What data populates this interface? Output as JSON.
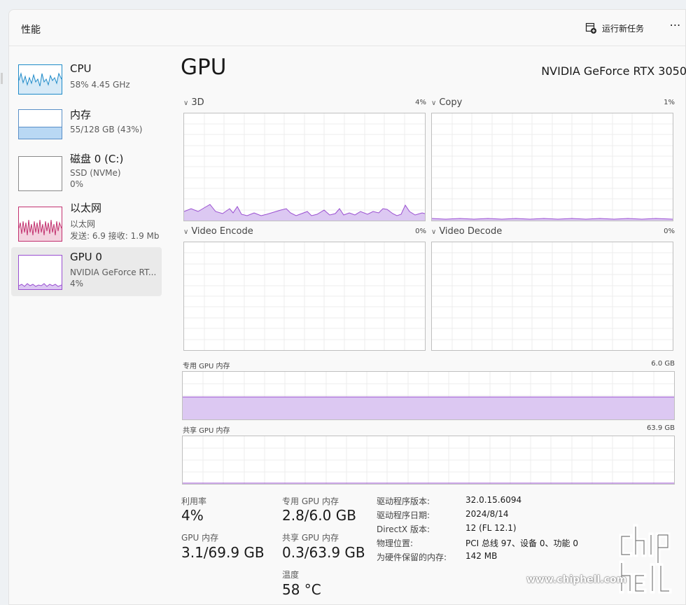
{
  "header": {
    "title": "性能",
    "run_task": "运行新任务",
    "more": "⋯"
  },
  "sidebar": {
    "items": [
      {
        "name": "CPU",
        "sub1": "58% 4.45 GHz",
        "sub2": ""
      },
      {
        "name": "内存",
        "sub1": "55/128 GB (43%)",
        "sub2": ""
      },
      {
        "name": "磁盘 0 (C:)",
        "sub1": "SSD (NVMe)",
        "sub2": "0%"
      },
      {
        "name": "以太网",
        "sub1": "以太网",
        "sub2": "发送: 6.9 接收: 1.9 Mb"
      },
      {
        "name": "GPU 0",
        "sub1": "NVIDIA GeForce RT...",
        "sub2": "4%"
      }
    ]
  },
  "main": {
    "title": "GPU",
    "model": "NVIDIA GeForce RTX 3050",
    "graphs": [
      {
        "label": "3D",
        "pct": "4%"
      },
      {
        "label": "Copy",
        "pct": "1%"
      },
      {
        "label": "Video Encode",
        "pct": "0%"
      },
      {
        "label": "Video Decode",
        "pct": "0%"
      }
    ],
    "dedicated": {
      "label": "专用 GPU 内存",
      "max": "6.0 GB",
      "fill": 0.47
    },
    "shared": {
      "label": "共享 GPU 内存",
      "max": "63.9 GB"
    }
  },
  "stats": {
    "util_label": "利用率",
    "util_value": "4%",
    "ded_label": "专用 GPU 内存",
    "ded_value": "2.8/6.0 GB",
    "gpu_mem_label": "GPU 内存",
    "gpu_mem_value": "3.1/69.9 GB",
    "shared_label": "共享 GPU 内存",
    "shared_value": "0.3/63.9 GB",
    "temp_label": "温度",
    "temp_value": "58 °C"
  },
  "info": [
    {
      "k": "驱动程序版本:",
      "v": "32.0.15.6094"
    },
    {
      "k": "驱动程序日期:",
      "v": "2024/8/14"
    },
    {
      "k": "DirectX 版本:",
      "v": "12 (FL 12.1)"
    },
    {
      "k": "物理位置:",
      "v": "PCI 总线 97、设备 0、功能 0"
    },
    {
      "k": "为硬件保留的内存:",
      "v": "142 MB"
    }
  ],
  "watermark": {
    "text": "www.chiphell.com"
  },
  "colors": {
    "gpu": "#9a4fd1",
    "gpu_fill": "#dcc8f2",
    "cpu": "#1f8bc9",
    "mem": "#b9d8f4",
    "net": "#c2316f"
  }
}
